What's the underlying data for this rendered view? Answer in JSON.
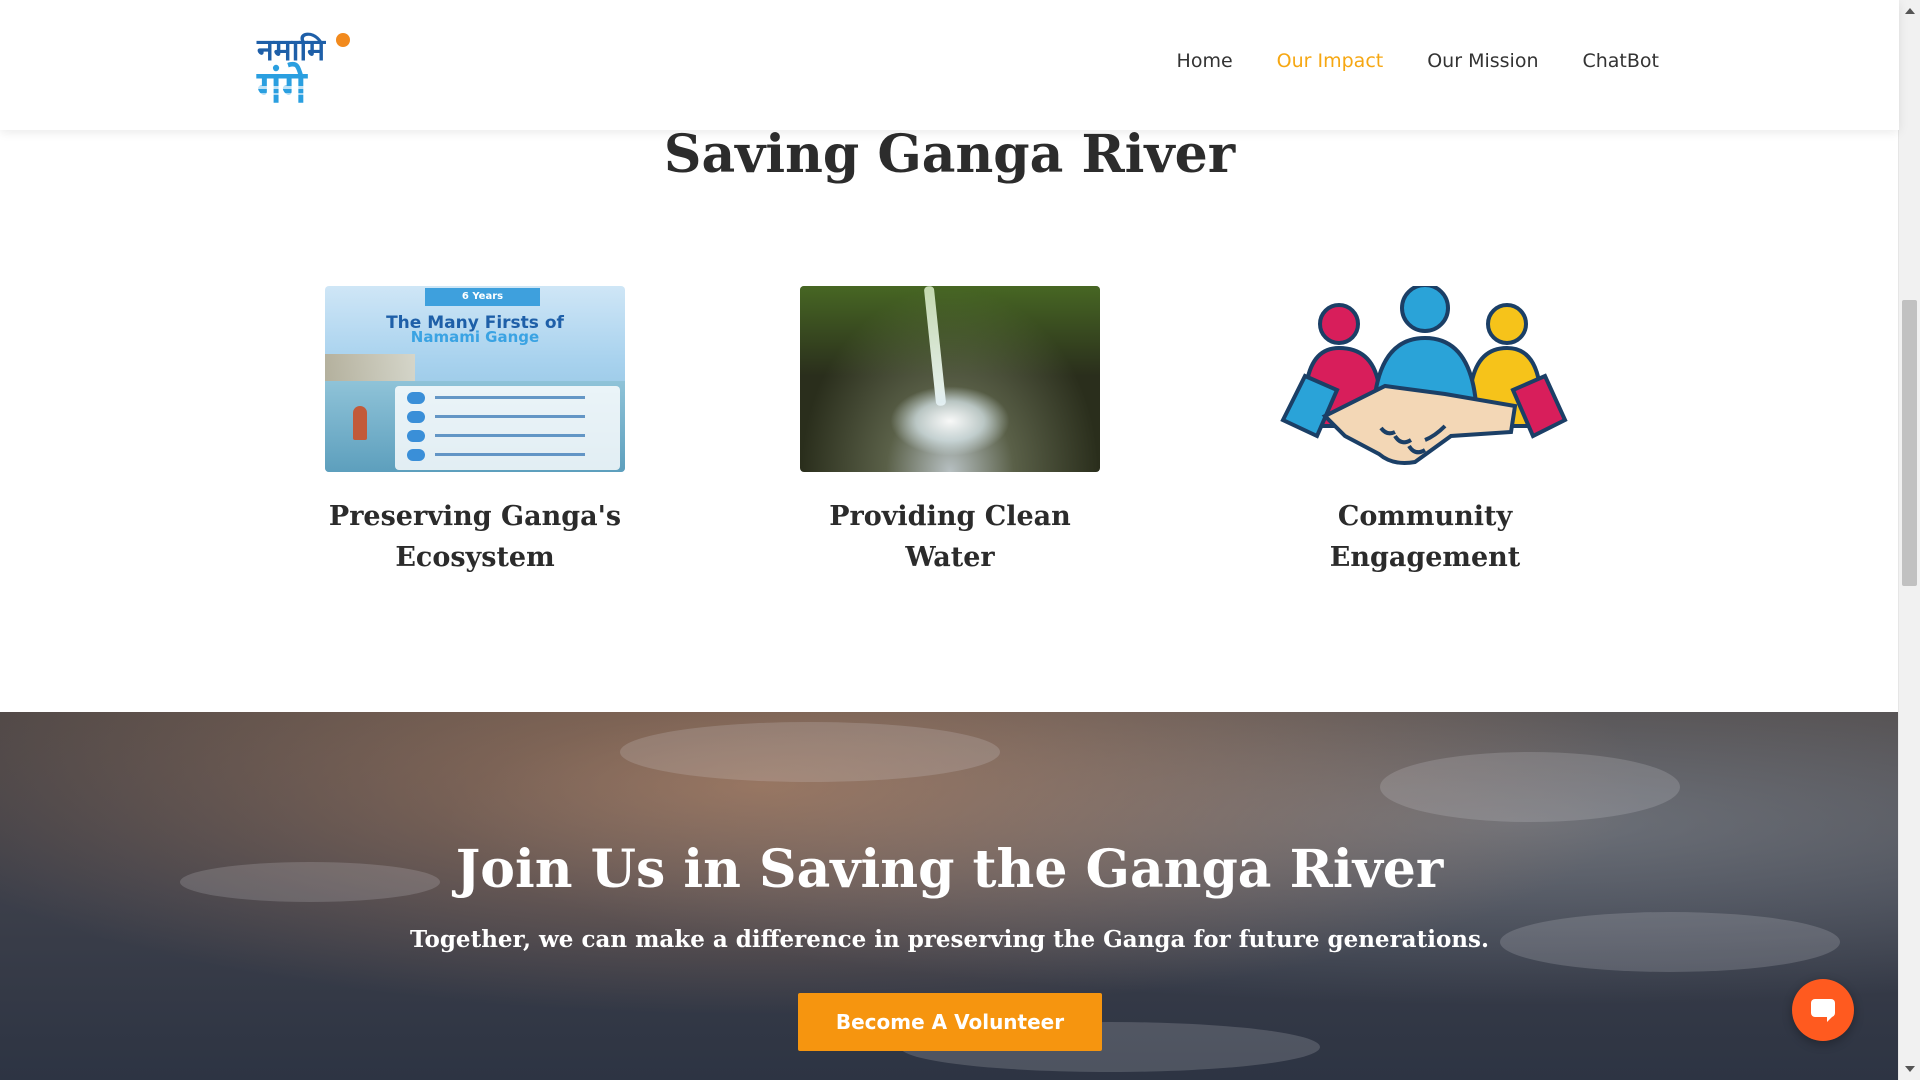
{
  "header": {
    "logo_text": "नमामि गंगे",
    "nav": [
      "Home",
      "Our Impact",
      "Our Mission",
      "ChatBot"
    ],
    "active_nav": "Our Impact"
  },
  "main": {
    "title": "Saving Ganga River",
    "cards": [
      {
        "label": "Preserving Ganga's Ecosystem",
        "image": "poster-image",
        "poster_band": "6 Years",
        "poster_title": "The Many Firsts of",
        "poster_subtitle": "Namami Gange"
      },
      {
        "label": "Providing Clean Water",
        "image": "water-stream-image"
      },
      {
        "label": "Community Engagement",
        "image": "community-handshake-icon"
      }
    ]
  },
  "banner": {
    "title": "Join Us in Saving the Ganga River",
    "subtitle": "Together, we can make a difference in preserving the Ganga for future generations.",
    "button_label": "Become A Volunteer"
  },
  "chat": {
    "icon": "chat-bubble-icon"
  },
  "colors": {
    "accent": "#f6a712",
    "button": "#f6950f",
    "chat": "#ff5a1f"
  }
}
